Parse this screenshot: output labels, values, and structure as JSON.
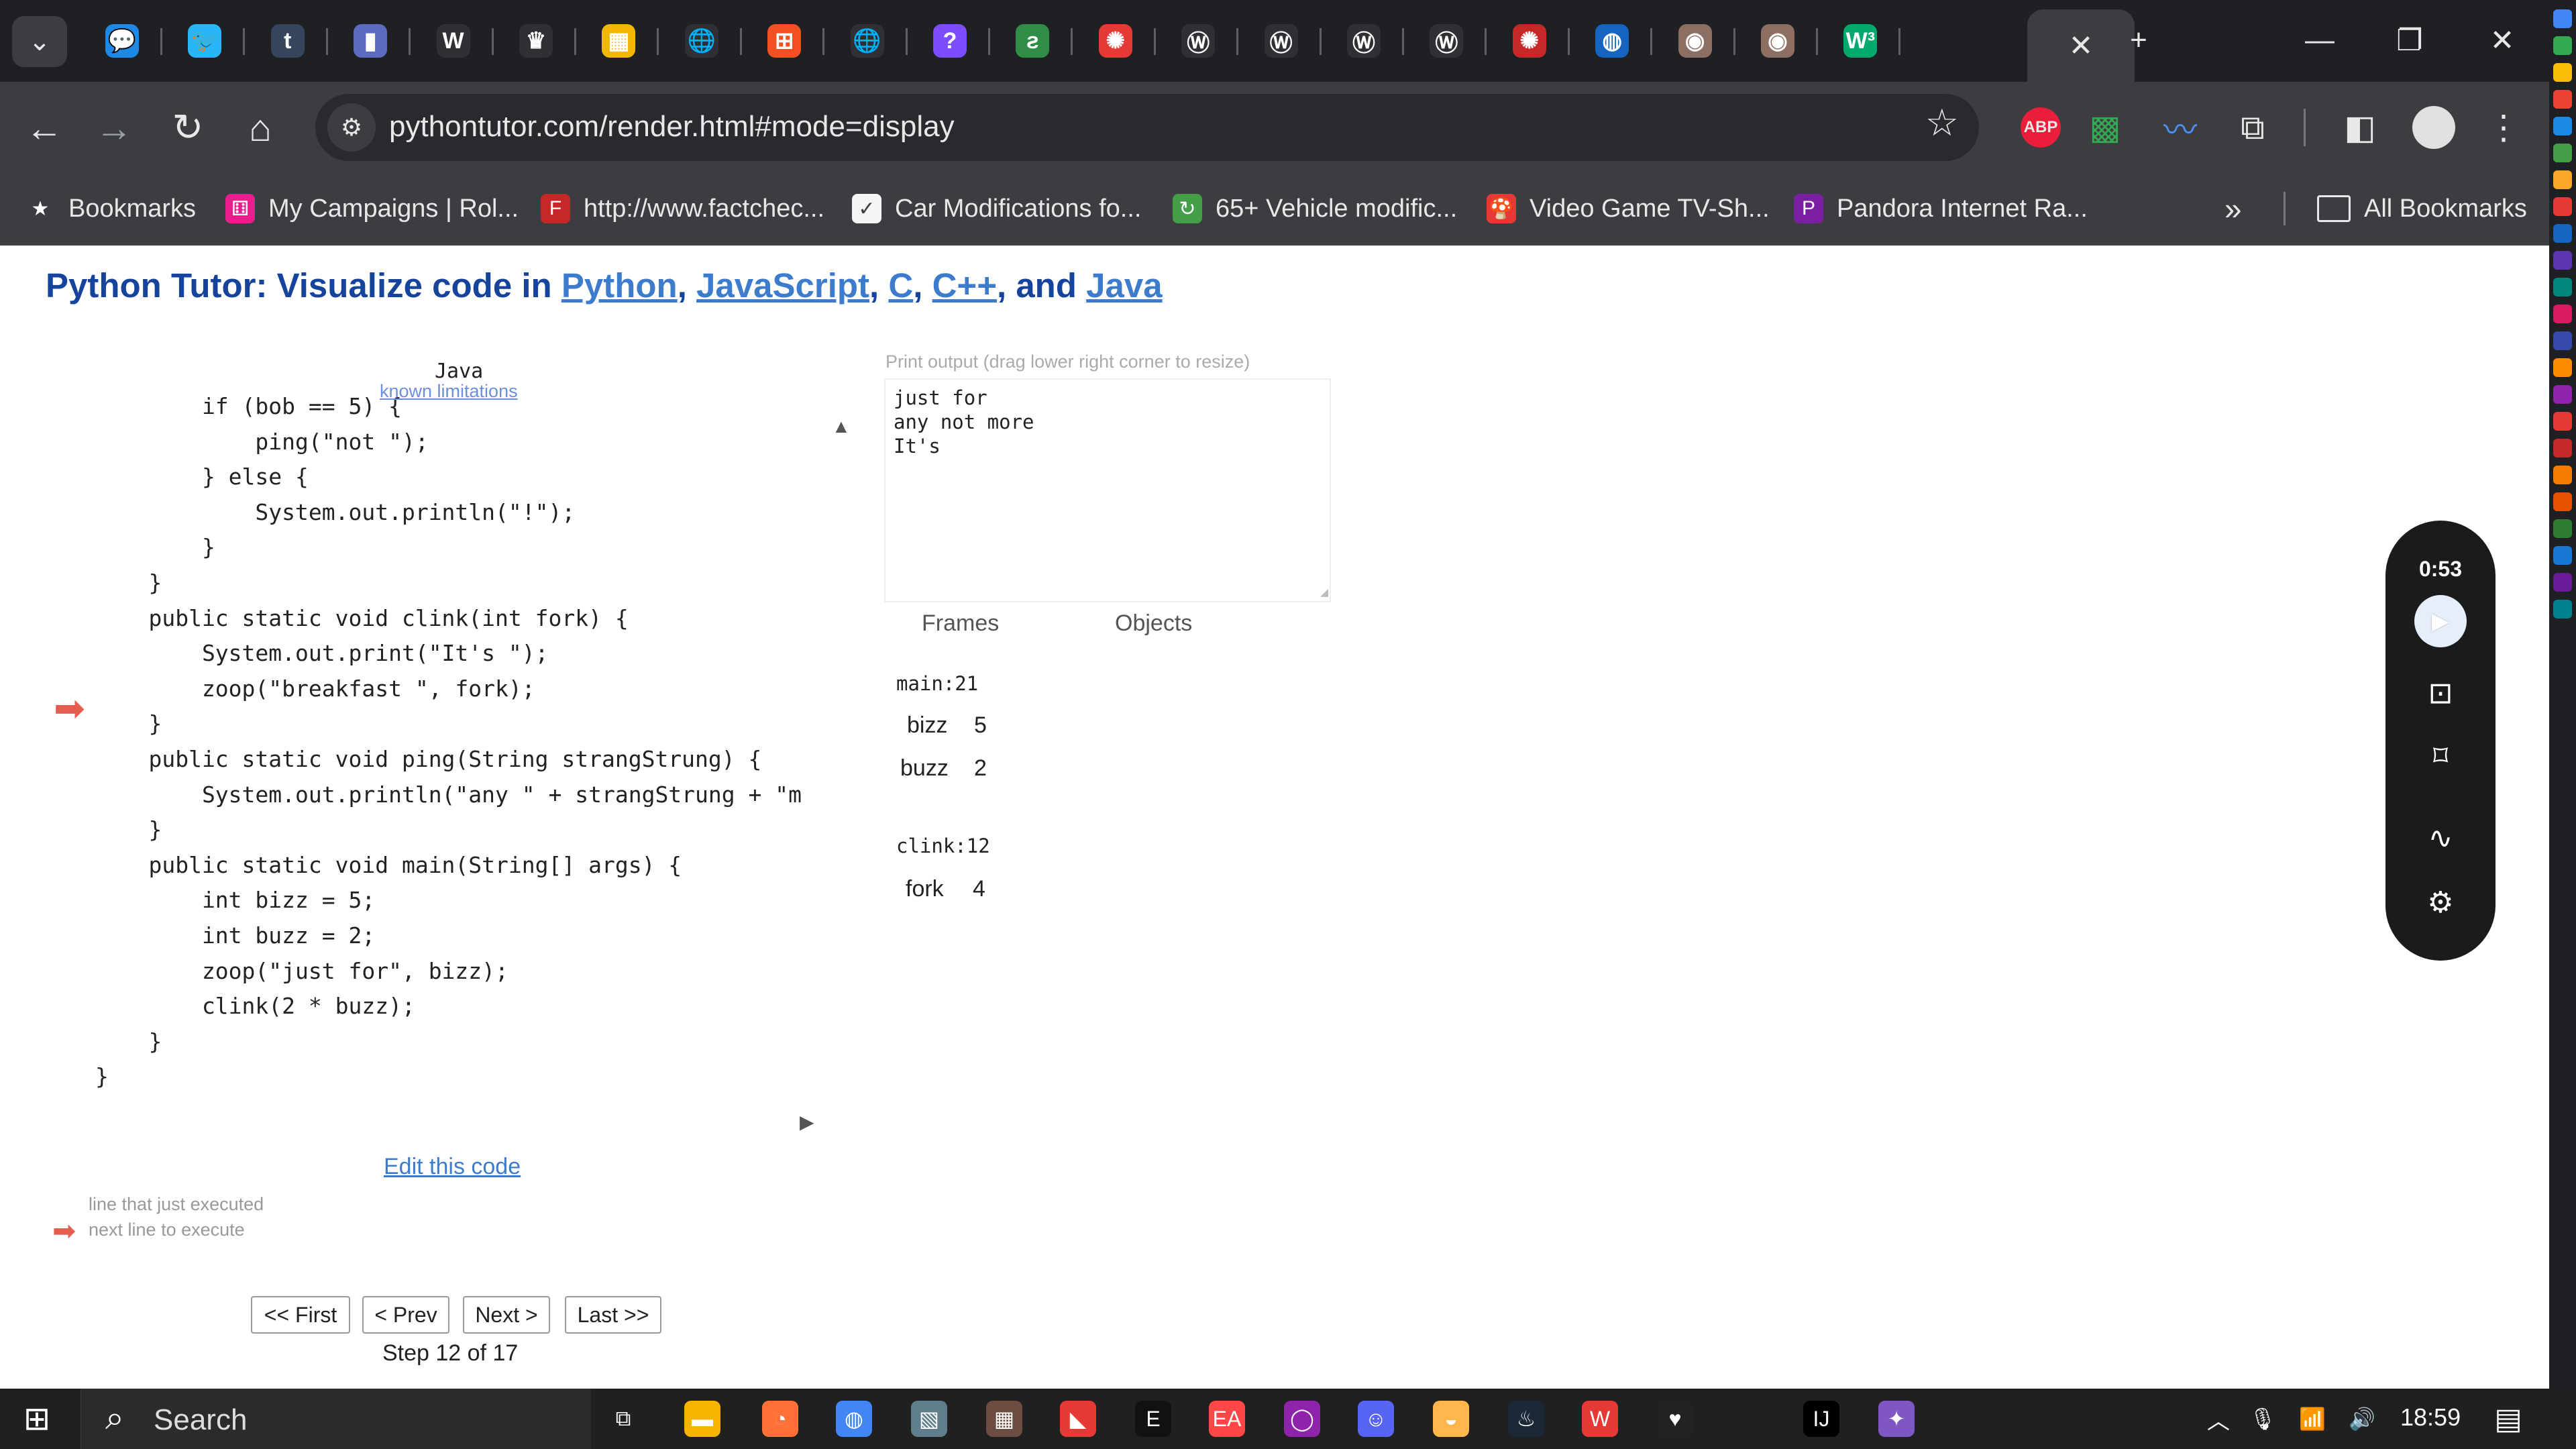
{
  "browser": {
    "tabs": [
      {
        "icon": "chat-bubble-icon",
        "color": "#1e88e5",
        "glyph": "💬"
      },
      {
        "icon": "bird-icon",
        "color": "#29b6f6",
        "glyph": "🐦"
      },
      {
        "icon": "tumblr-icon",
        "color": "#35465c",
        "glyph": "t"
      },
      {
        "icon": "bookmark-app-icon",
        "color": "#5c6bc0",
        "glyph": "▮"
      },
      {
        "icon": "wikipedia-icon",
        "color": "#2f3033",
        "glyph": "W"
      },
      {
        "icon": "crown-icon",
        "color": "#2f3033",
        "glyph": "♛"
      },
      {
        "icon": "grid-app-icon",
        "color": "#f2b705",
        "glyph": "▦"
      },
      {
        "icon": "globe-icon",
        "color": "#2f3033",
        "glyph": "🌐"
      },
      {
        "icon": "microsoft-icon",
        "color": "#f25022",
        "glyph": "⊞"
      },
      {
        "icon": "globe-icon",
        "color": "#2f3033",
        "glyph": "🌐"
      },
      {
        "icon": "question-icon",
        "color": "#7c4dff",
        "glyph": "?"
      },
      {
        "icon": "geeks-icon",
        "color": "#2f8d46",
        "glyph": "ƨ"
      },
      {
        "icon": "canvas-icon",
        "color": "#e53935",
        "glyph": "✺"
      },
      {
        "icon": "w-circle-icon",
        "color": "#2f3033",
        "glyph": "Ⓦ"
      },
      {
        "icon": "w-circle-icon",
        "color": "#2f3033",
        "glyph": "Ⓦ"
      },
      {
        "icon": "w-circle-icon",
        "color": "#2f3033",
        "glyph": "Ⓦ"
      },
      {
        "icon": "w-circle-icon",
        "color": "#2f3033",
        "glyph": "Ⓦ"
      },
      {
        "icon": "canvas-icon",
        "color": "#c62828",
        "glyph": "✺"
      },
      {
        "icon": "earth-icon",
        "color": "#1565c0",
        "glyph": "◍"
      },
      {
        "icon": "avatar-icon",
        "color": "#8d6e63",
        "glyph": "◉"
      },
      {
        "icon": "avatar-icon",
        "color": "#8d6e63",
        "glyph": "◉"
      },
      {
        "icon": "w3-icon",
        "color": "#04aa6d",
        "glyph": "W³"
      }
    ],
    "active_tab_close": "✕",
    "new_tab": "+",
    "window_controls": {
      "minimize": "—",
      "restore": "❐",
      "close": "✕"
    },
    "url": "pythontutor.com/render.html#mode=display",
    "bookmarks": [
      {
        "label": "Bookmarks",
        "icon": "star-icon",
        "color": "#3c3d40",
        "glyph": "★"
      },
      {
        "label": "My Campaigns | Rol...",
        "icon": "roll20-icon",
        "color": "#e91e8c",
        "glyph": "⚅"
      },
      {
        "label": "http://www.factchec...",
        "icon": "factcheck-icon",
        "color": "#c62828",
        "glyph": "F"
      },
      {
        "label": "Car Modifications fo...",
        "icon": "page-icon",
        "color": "#f5f5f5",
        "glyph": "✓"
      },
      {
        "label": "65+ Vehicle modific...",
        "icon": "refresh-green-icon",
        "color": "#43a047",
        "glyph": "↻"
      },
      {
        "label": "Video Game TV-Sh...",
        "icon": "mushroom-icon",
        "color": "#e53935",
        "glyph": "🍄"
      },
      {
        "label": "Pandora Internet Ra...",
        "icon": "pandora-icon",
        "color": "#7b1fa2",
        "glyph": "P"
      }
    ],
    "bookmarks_overflow": "»",
    "all_bookmarks": "All Bookmarks"
  },
  "page": {
    "heading_prefix": "Python Tutor: Visualize code in ",
    "heading_links": [
      "Python",
      "JavaScript",
      "C",
      "C++",
      "Java"
    ],
    "heading_seps": [
      ", ",
      ", ",
      ", ",
      ", and "
    ],
    "language": "Java",
    "known_limitations": "known limitations",
    "code_lines": [
      "        if (bob == 5) {",
      "            ping(\"not \");",
      "        } else {",
      "            System.out.println(\"!\");",
      "        }",
      "    }",
      "    public static void clink(int fork) {",
      "        System.out.print(\"It's \");",
      "        zoop(\"breakfast \", fork);",
      "    }",
      "    public static void ping(String strangStrung) {",
      "        System.out.println(\"any \" + strangStrung + \"m",
      "    }",
      "    public static void main(String[] args) {",
      "        int bizz = 5;",
      "        int buzz = 2;",
      "        zoop(\"just for\", bizz);",
      "        clink(2 * buzz);",
      "    }",
      "}"
    ],
    "edit_code": "Edit this code",
    "legend_executed": "line that just executed",
    "legend_next": "next line to execute",
    "nav": {
      "first": "<< First",
      "prev": "< Prev",
      "next": "Next >",
      "last": "Last >>"
    },
    "step_counter": "Step 12 of 17",
    "print_output_label": "Print output (drag lower right corner to resize)",
    "print_output_lines": [
      "just for",
      "any not more",
      "It's"
    ],
    "frames_header": "Frames",
    "objects_header": "Objects",
    "frames": [
      {
        "name": "main:21",
        "vars": [
          {
            "name": "bizz",
            "value": "5"
          },
          {
            "name": "buzz",
            "value": "2"
          }
        ]
      },
      {
        "name": "clink:12",
        "vars": [
          {
            "name": "fork",
            "value": "4"
          }
        ]
      }
    ]
  },
  "recorder": {
    "time": "0:53"
  },
  "taskbar": {
    "search": "Search",
    "time": "18:59"
  }
}
